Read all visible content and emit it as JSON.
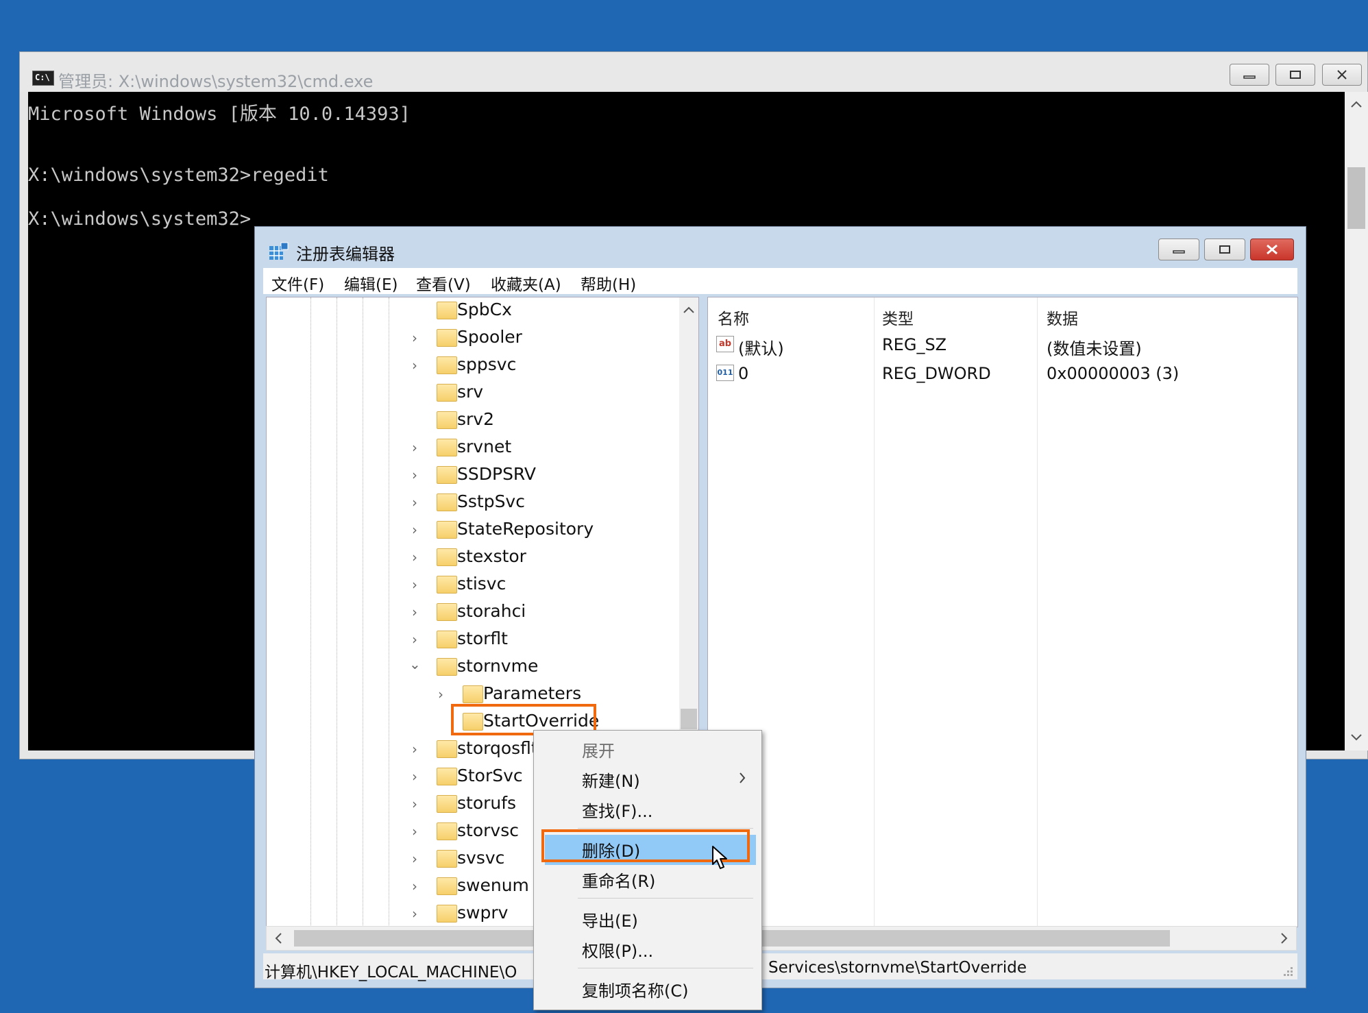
{
  "cmd": {
    "title": "管理员: X:\\windows\\system32\\cmd.exe",
    "lines": [
      "Microsoft Windows [版本 10.0.14393]",
      "",
      "X:\\windows\\system32>regedit",
      "",
      "X:\\windows\\system32>"
    ]
  },
  "regedit": {
    "title": "注册表编辑器",
    "menu": [
      "文件(F)",
      "编辑(E)",
      "查看(V)",
      "收藏夹(A)",
      "帮助(H)"
    ],
    "tree": [
      {
        "label": "SpbCx",
        "expander": ""
      },
      {
        "label": "Spooler",
        "expander": "collapsed"
      },
      {
        "label": "sppsvc",
        "expander": "collapsed"
      },
      {
        "label": "srv",
        "expander": ""
      },
      {
        "label": "srv2",
        "expander": ""
      },
      {
        "label": "srvnet",
        "expander": "collapsed"
      },
      {
        "label": "SSDPSRV",
        "expander": "collapsed"
      },
      {
        "label": "SstpSvc",
        "expander": "collapsed"
      },
      {
        "label": "StateRepository",
        "expander": "collapsed"
      },
      {
        "label": "stexstor",
        "expander": "collapsed"
      },
      {
        "label": "stisvc",
        "expander": "collapsed"
      },
      {
        "label": "storahci",
        "expander": "collapsed"
      },
      {
        "label": "storflt",
        "expander": "collapsed"
      },
      {
        "label": "stornvme",
        "expander": "expanded"
      },
      {
        "label": "Parameters",
        "expander": "collapsed",
        "child": true
      },
      {
        "label": "StartOverride",
        "expander": "",
        "child": true,
        "selected": true
      },
      {
        "label": "storqosflt",
        "expander": "collapsed"
      },
      {
        "label": "StorSvc",
        "expander": "collapsed"
      },
      {
        "label": "storufs",
        "expander": "collapsed"
      },
      {
        "label": "storvsc",
        "expander": "collapsed"
      },
      {
        "label": "svsvc",
        "expander": "collapsed"
      },
      {
        "label": "swenum",
        "expander": "collapsed"
      },
      {
        "label": "swprv",
        "expander": "collapsed"
      }
    ],
    "columns": {
      "name": "名称",
      "type": "类型",
      "data": "数据"
    },
    "values": [
      {
        "icon": "ab",
        "name": "(默认)",
        "type": "REG_SZ",
        "data": "(数值未设置)"
      },
      {
        "icon": "011",
        "name": "0",
        "type": "REG_DWORD",
        "data": "0x00000003 (3)"
      }
    ],
    "status_left": "计算机\\HKEY_LOCAL_MACHINE\\O",
    "status_right": "Services\\stornvme\\StartOverride"
  },
  "context_menu": {
    "items": [
      {
        "label": "展开",
        "disabled": true
      },
      {
        "label": "新建(N)",
        "submenu": true
      },
      {
        "label": "查找(F)..."
      },
      {
        "label": "删除(D)",
        "highlighted": true
      },
      {
        "label": "重命名(R)"
      },
      {
        "label": "导出(E)"
      },
      {
        "label": "权限(P)..."
      },
      {
        "label": "复制项名称(C)"
      }
    ]
  },
  "colors": {
    "desktop": "#1f66b3",
    "highlight_box": "#f0690f",
    "menu_highlight": "#91c9f7",
    "close_button": "#c9352b"
  }
}
